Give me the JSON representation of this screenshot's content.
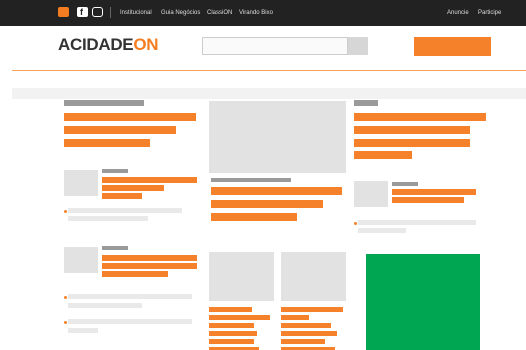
{
  "topbar": {
    "icons": [
      {
        "name": "on-logo-icon",
        "color": "#f37d20",
        "glyph": "ON"
      },
      {
        "name": "facebook-icon",
        "color": "#ffffff",
        "glyph": "f"
      },
      {
        "name": "instagram-icon",
        "color": "#ffffff",
        "glyph": "◎"
      }
    ],
    "nav": [
      "Institucional",
      "Guia Negócios",
      "ClassiON",
      "Virando Bixo"
    ],
    "right": [
      "Anuncie",
      "Participe"
    ]
  },
  "header": {
    "logo_main": "ACIDADE",
    "logo_accent": "ON",
    "brand_color": "#f5822a"
  },
  "colors": {
    "accent": "#f5822a",
    "ad_green": "#00a651",
    "topbar": "#222222"
  }
}
